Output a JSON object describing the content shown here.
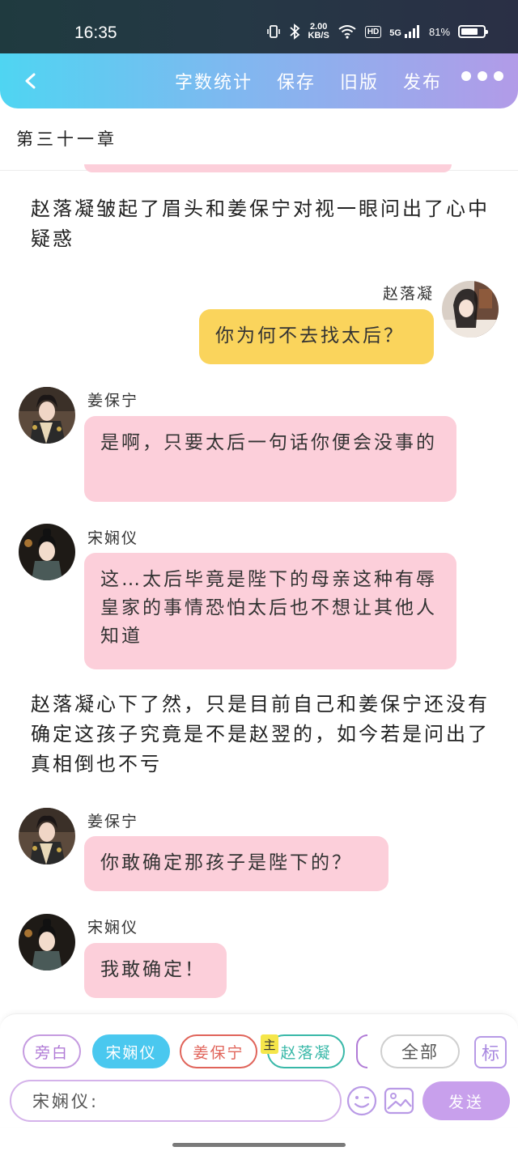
{
  "status_bar": {
    "time": "16:35",
    "net_speed_value": "2.00",
    "net_speed_unit": "KB/S",
    "hd_label": "HD",
    "signal_label": "5G",
    "battery_percent": "81",
    "battery_level": 0.81
  },
  "nav": {
    "actions": [
      "字数统计",
      "保存",
      "旧版",
      "发布"
    ]
  },
  "chapter": {
    "title": "第三十一章"
  },
  "messages": [
    {
      "type": "narration",
      "text": "赵落凝皱起了眉头和姜保宁对视一眼问出了心中疑惑"
    },
    {
      "type": "bubble",
      "speaker": "赵落凝",
      "text": "你为何不去找太后？",
      "color": "#fad45c"
    },
    {
      "type": "bubble",
      "speaker": "姜保宁",
      "text": "是啊，只要太后一句话你便会没事的",
      "color": "#fccfda"
    },
    {
      "type": "bubble",
      "speaker": "宋娴仪",
      "text": "这…太后毕竟是陛下的母亲这种有辱皇家的事情恐怕太后也不想让其他人知道",
      "color": "#fccfda"
    },
    {
      "type": "narration",
      "text": "赵落凝心下了然，只是目前自己和姜保宁还没有确定这孩子究竟是不是赵翌的，如今若是问出了真相倒也不亏"
    },
    {
      "type": "bubble",
      "speaker": "姜保宁",
      "text": "你敢确定那孩子是陛下的？",
      "color": "#fccfda"
    },
    {
      "type": "bubble",
      "speaker": "宋娴仪",
      "text": "我敢确定！",
      "color": "#fccfda"
    }
  ],
  "roles": {
    "narrator": "旁白",
    "song": "宋娴仪",
    "jiang": "姜保宁",
    "main_badge": "主",
    "zhao": "赵落凝",
    "all": "全部",
    "mark": "标"
  },
  "input": {
    "prefix": "宋娴仪:"
  },
  "send_label": "发送",
  "colors": {
    "accent_cyan": "#4ac8ef",
    "accent_purple": "#c8a0ec",
    "bubble_pink": "#fccfda",
    "bubble_yellow": "#fad45c"
  }
}
